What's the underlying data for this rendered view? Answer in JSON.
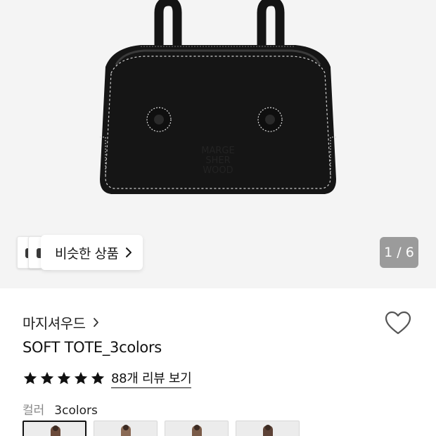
{
  "gallery": {
    "similar_button_label": "비슷한 상품",
    "pager_text": "1 / 6",
    "current_image": 1,
    "total_images": 6
  },
  "product": {
    "brand": "마지셔우드",
    "title": "SOFT TOTE_3colors",
    "rating_stars": 5,
    "review_link_text": "88개 리뷰 보기"
  },
  "options": {
    "label": "컬러",
    "value": "3colors",
    "swatch_count": 4,
    "selected_index": 0
  },
  "colors": {
    "hero_bg": "#f4f4f4",
    "pager_bg": "#9b9b9b",
    "text_primary": "#111111",
    "text_muted": "#888888"
  },
  "icons": {
    "similar_chevron": "chevron-right-icon",
    "brand_chevron": "chevron-right-icon",
    "wishlist": "heart-outline-icon",
    "star": "star-filled-icon"
  }
}
